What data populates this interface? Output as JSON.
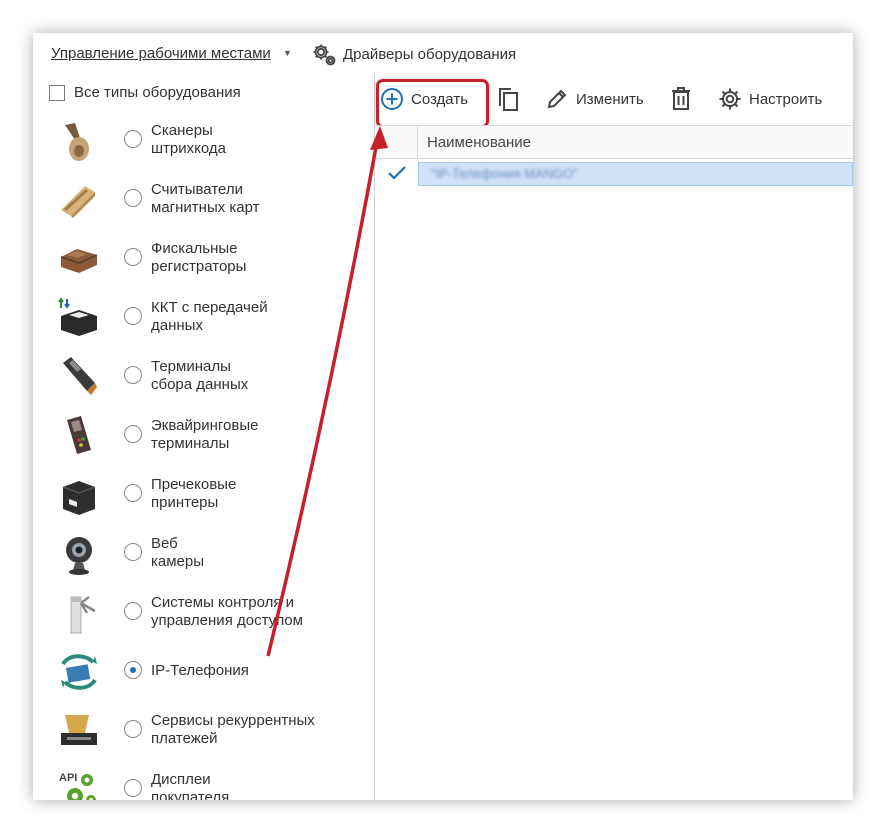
{
  "header": {
    "workplaces_menu": "Управление рабочими местами",
    "drivers_link": "Драйверы оборудования"
  },
  "filter": {
    "all_types_label": "Все типы оборудования",
    "all_types_checked": false
  },
  "equipment_types": [
    {
      "lines": [
        "Сканеры",
        "штрихкода"
      ],
      "icon": "barcode-scanner-icon",
      "selected": false
    },
    {
      "lines": [
        "Считыватели",
        "магнитных карт"
      ],
      "icon": "magnetic-card-reader-icon",
      "selected": false
    },
    {
      "lines": [
        "Фискальные",
        "регистраторы"
      ],
      "icon": "fiscal-register-icon",
      "selected": false
    },
    {
      "lines": [
        "ККТ с передачей",
        "данных"
      ],
      "icon": "online-cash-register-icon",
      "selected": false
    },
    {
      "lines": [
        "Терминалы",
        "сбора данных"
      ],
      "icon": "data-collection-terminal-icon",
      "selected": false
    },
    {
      "lines": [
        "Эквайринговые",
        "терминалы"
      ],
      "icon": "payment-terminal-icon",
      "selected": false
    },
    {
      "lines": [
        "Пречековые",
        "принтеры"
      ],
      "icon": "receipt-printer-icon",
      "selected": false
    },
    {
      "lines": [
        "Веб",
        "камеры"
      ],
      "icon": "webcam-icon",
      "selected": false
    },
    {
      "lines": [
        "Системы контроля и",
        "управления доступом"
      ],
      "icon": "turnstile-icon",
      "selected": false
    },
    {
      "lines": [
        "IP-Телефония"
      ],
      "icon": "ip-telephony-icon",
      "selected": true
    },
    {
      "lines": [
        "Сервисы рекуррентных",
        "платежей"
      ],
      "icon": "recurring-payments-icon",
      "selected": false
    },
    {
      "lines": [
        "Дисплеи",
        "покупателя"
      ],
      "icon": "customer-display-api-icon",
      "selected": false
    }
  ],
  "toolbar": {
    "create_label": "Создать",
    "edit_label": "Изменить",
    "settings_label": "Настроить"
  },
  "table": {
    "column_name": "Наименование",
    "rows": [
      {
        "name": "\"IP-Телефония MANGO\"",
        "checked": true
      }
    ]
  },
  "colors": {
    "highlight": "#c6202a",
    "accent": "#1f6fb5",
    "row_selected": "#cfe2f7"
  }
}
